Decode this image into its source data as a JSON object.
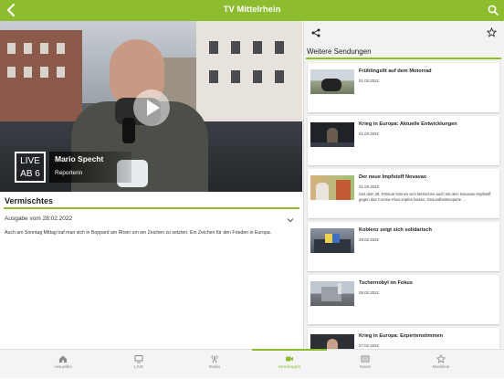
{
  "header": {
    "title": "TV Mittelrhein"
  },
  "player": {
    "logo_line1": "LIVE",
    "logo_line2": "AB 6",
    "reporter_name": "Mario Specht",
    "reporter_role": "Reporterin"
  },
  "main": {
    "section_title": "Vermischtes",
    "edition": "Ausgabe vom 28.02.2022",
    "description": "Auch am Sonntag Mittag traf man sich in Boppard am Rhein um ein Zeichen zu setzten. Ein Zeichen für den Frieden in Europa."
  },
  "sidebar": {
    "section_title": "Weitere Sendungen",
    "items": [
      {
        "title": "Frühlingsfit auf dem Motorrad",
        "date": "01.03.2022",
        "snippet": ""
      },
      {
        "title": "Krieg in Europa: Aktuelle Entwicklungen",
        "date": "01.03.2022",
        "snippet": ""
      },
      {
        "title": "Der neue Impfstoff Novavax",
        "date": "01.03.2022",
        "snippet": "Seit dem 28. Februar können sich Menschen auch mit dem Novavax-Impfstoff gegen das Corona-Virus impfen lassen. Gesundheitsexperte ..."
      },
      {
        "title": "Koblenz zeigt sich solidarisch",
        "date": "28.02.2022",
        "snippet": ""
      },
      {
        "title": "Tschernobyl im Fokus",
        "date": "28.02.2022",
        "snippet": ""
      },
      {
        "title": "Krieg in Europa: Expertenstimmen",
        "date": "27.02.2022",
        "snippet": ""
      }
    ]
  },
  "tabs": [
    {
      "label": "Aktuelles",
      "icon": "home-icon"
    },
    {
      "label": "LIVE",
      "icon": "tv-icon"
    },
    {
      "label": "Radio",
      "icon": "radio-icon"
    },
    {
      "label": "Sendungen",
      "icon": "video-camera-icon",
      "active": true
    },
    {
      "label": "News",
      "icon": "news-icon"
    },
    {
      "label": "Merkliste",
      "icon": "star-icon"
    }
  ],
  "colors": {
    "accent": "#8dbd2f",
    "tab_inactive": "#8a8a8a"
  }
}
